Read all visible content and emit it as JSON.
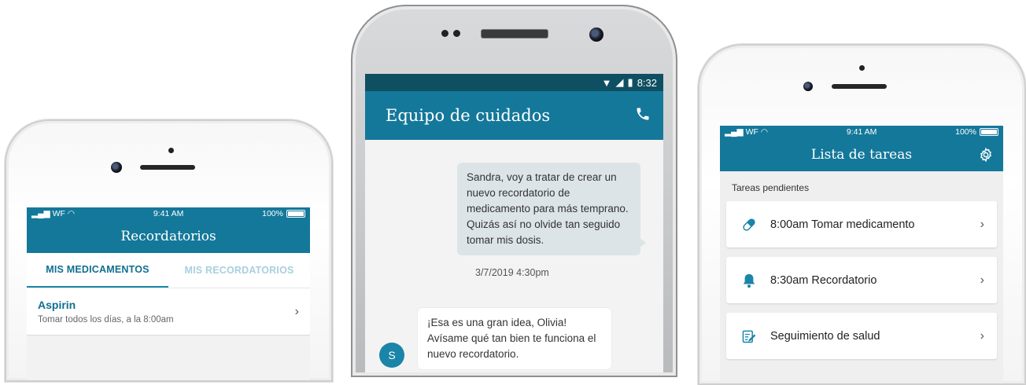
{
  "left_phone": {
    "status": {
      "signal": "WF",
      "time": "9:41 AM",
      "battery": "100%"
    },
    "header_title": "Recordatorios",
    "tabs": [
      {
        "label": "MIS MEDICAMENTOS",
        "active": true
      },
      {
        "label": "MIS RECORDATORIOS",
        "active": false
      }
    ],
    "medications": [
      {
        "name": "Aspirin",
        "schedule": "Tomar todos los días, a la 8:00am"
      }
    ],
    "chevron": "›"
  },
  "center_phone": {
    "status": {
      "time": "8:32"
    },
    "header_title": "Equipo de cuidados",
    "messages": [
      {
        "direction": "outgoing",
        "text": "Sandra, voy a tratar de crear un nuevo recordatorio de medicamento para más temprano. Quizás así no olvide tan seguido tomar mis dosis."
      },
      {
        "direction": "incoming",
        "sender_initial": "S",
        "text": "¡Esa es una gran idea, Olivia! Avísame qué tan bien te funciona el nuevo recordatorio."
      }
    ],
    "timestamp": "3/7/2019 4:30pm",
    "icons": [
      "wifi-icon",
      "cell-signal-icon",
      "battery-icon",
      "phone-icon"
    ]
  },
  "right_phone": {
    "status": {
      "signal": "WF",
      "time": "9:41 AM",
      "battery": "100%"
    },
    "header_title": "Lista de tareas",
    "section_label": "Tareas pendientes",
    "tasks": [
      {
        "label": "8:00am Tomar medicamento",
        "icon": "pill-icon"
      },
      {
        "label": "8:30am Recordatorio",
        "icon": "bell-icon"
      },
      {
        "label": "Seguimiento de salud",
        "icon": "health-check-icon"
      }
    ],
    "chevron": "›"
  },
  "colors": {
    "primary": "#14789a",
    "dark_status": "#0f4f62",
    "accent": "#1b84a9",
    "inactive_tab": "#a8d0de"
  }
}
